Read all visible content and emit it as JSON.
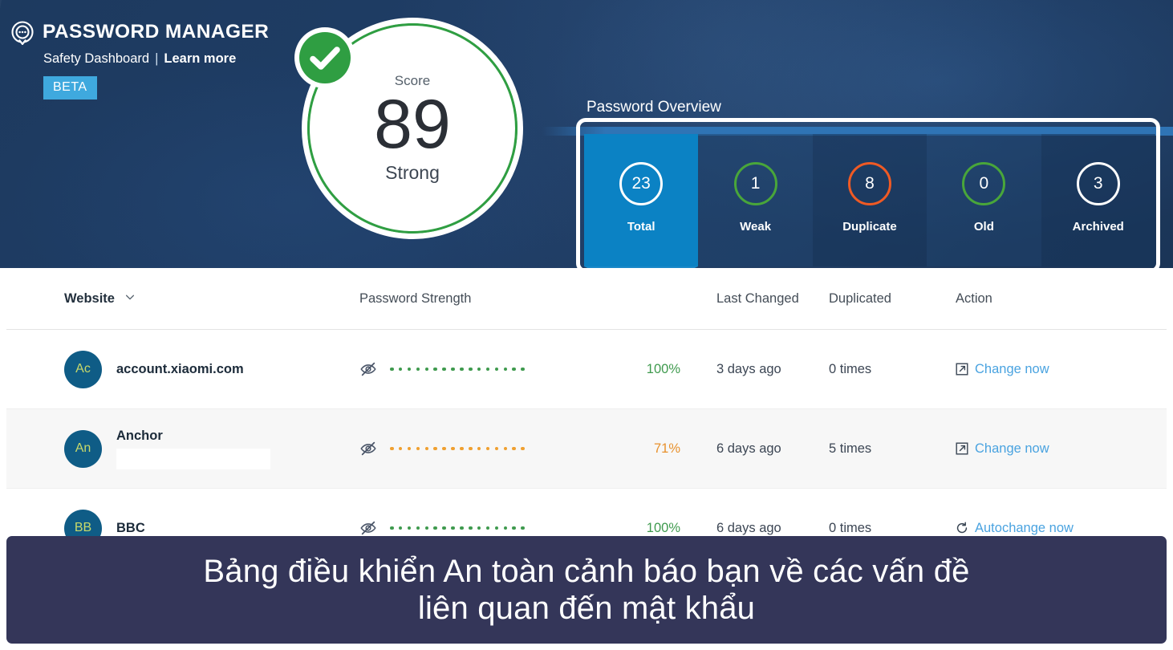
{
  "header": {
    "brand_title": "PASSWORD MANAGER",
    "subtitle": "Safety Dashboard",
    "separator": "|",
    "learn_more": "Learn more",
    "beta_badge": "BETA",
    "logo_icon": "speech-bubble-dots-icon",
    "bg_color": "#1f3d66"
  },
  "score": {
    "label": "Score",
    "value": "89",
    "state": "Strong",
    "check_icon": "check-circle-icon",
    "ring_color": "#2f9e42"
  },
  "overview": {
    "title": "Password Overview",
    "tabs": [
      {
        "count": "23",
        "label": "Total",
        "ring": "white",
        "active": true
      },
      {
        "count": "1",
        "label": "Weak",
        "ring": "green",
        "active": false
      },
      {
        "count": "8",
        "label": "Duplicate",
        "ring": "orange",
        "active": false
      },
      {
        "count": "0",
        "label": "Old",
        "ring": "green",
        "active": false
      },
      {
        "count": "3",
        "label": "Archived",
        "ring": "white",
        "active": false
      }
    ],
    "active_accent": "#0b82c4",
    "green": "#49a63a",
    "orange": "#ef5a24"
  },
  "table": {
    "columns": {
      "website": "Website",
      "sort_icon": "chevron-down-icon",
      "password_strength": "Password Strength",
      "last_changed": "Last Changed",
      "duplicated": "Duplicated",
      "action": "Action"
    },
    "rows": [
      {
        "initials": "Ac",
        "site": "account.xiaomi.com",
        "redacted": false,
        "visibility_icon": "eye-slash-icon",
        "dot_color": "#3f9a4e",
        "dot_count": 16,
        "percent": "100%",
        "percent_class": "green",
        "last_changed": "3 days ago",
        "duplicated": "0 times",
        "action_label": "Change now",
        "action_icon": "external-link-icon"
      },
      {
        "initials": "An",
        "site": "Anchor",
        "redacted": true,
        "visibility_icon": "eye-slash-icon",
        "dot_color": "#f0a030",
        "dot_count": 16,
        "percent": "71%",
        "percent_class": "orange",
        "last_changed": "6 days ago",
        "duplicated": "5 times",
        "action_label": "Change now",
        "action_icon": "external-link-icon"
      },
      {
        "initials": "BB",
        "site": "BBC",
        "redacted": false,
        "visibility_icon": "eye-slash-icon",
        "dot_color": "#3f9a4e",
        "dot_count": 16,
        "percent": "100%",
        "percent_class": "green",
        "last_changed": "6 days ago",
        "duplicated": "0 times",
        "action_label": "Autochange now",
        "action_icon": "refresh-icon"
      }
    ]
  },
  "caption": {
    "line1": "Bảng điều khiển An toàn cảnh báo bạn về các vấn đề",
    "line2": "liên quan đến mật khẩu",
    "bg_color": "#343659"
  }
}
